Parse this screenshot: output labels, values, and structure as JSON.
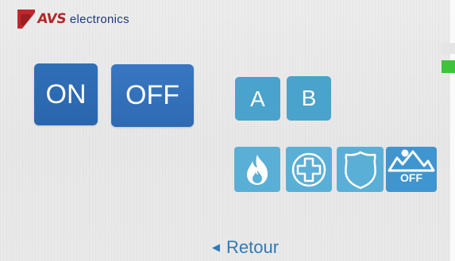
{
  "logo": {
    "brand": "AVS",
    "word": "electronics",
    "colors": {
      "brand": "#b4262a",
      "word": "#1f3a78"
    }
  },
  "buttons": {
    "on_label": "ON",
    "off_label": "OFF",
    "a_label": "A",
    "b_label": "B"
  },
  "icon_buttons": [
    {
      "icon": "fire-icon"
    },
    {
      "icon": "medical-cross-icon"
    },
    {
      "icon": "police-shield-icon"
    },
    {
      "icon": "alpine-mountain-icon",
      "label": "OFF"
    }
  ],
  "indicators": {
    "status_color": "#3ec43a"
  },
  "navigation": {
    "back_label": "Retour"
  },
  "colors": {
    "on_off_button": "#2f6fb7",
    "ab_button": "#4aa3cc",
    "icon_button": "#5aafd6",
    "alpine_button": "#3f95cf",
    "back_link": "#2f7ab8"
  }
}
